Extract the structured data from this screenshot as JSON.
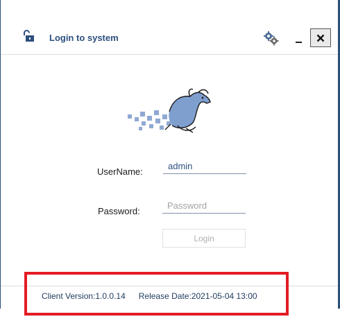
{
  "window": {
    "title": "Login to system",
    "close_label": "✖"
  },
  "form": {
    "username_label": "UserName:",
    "username_value": "admin",
    "password_label": "Password:",
    "password_placeholder": "Password",
    "login_label": "Login"
  },
  "footer": {
    "client_version": "Client Version:1.0.0.14",
    "release_date": "Release Date:2021-05-04 13:00"
  },
  "icons": {
    "lock": "unlock-icon",
    "settings": "gears-icon",
    "logo": "horse-logo"
  },
  "colors": {
    "accent": "#2d4f7e",
    "highlight": "#e31b23",
    "logo_fill": "#7f9fcf"
  }
}
